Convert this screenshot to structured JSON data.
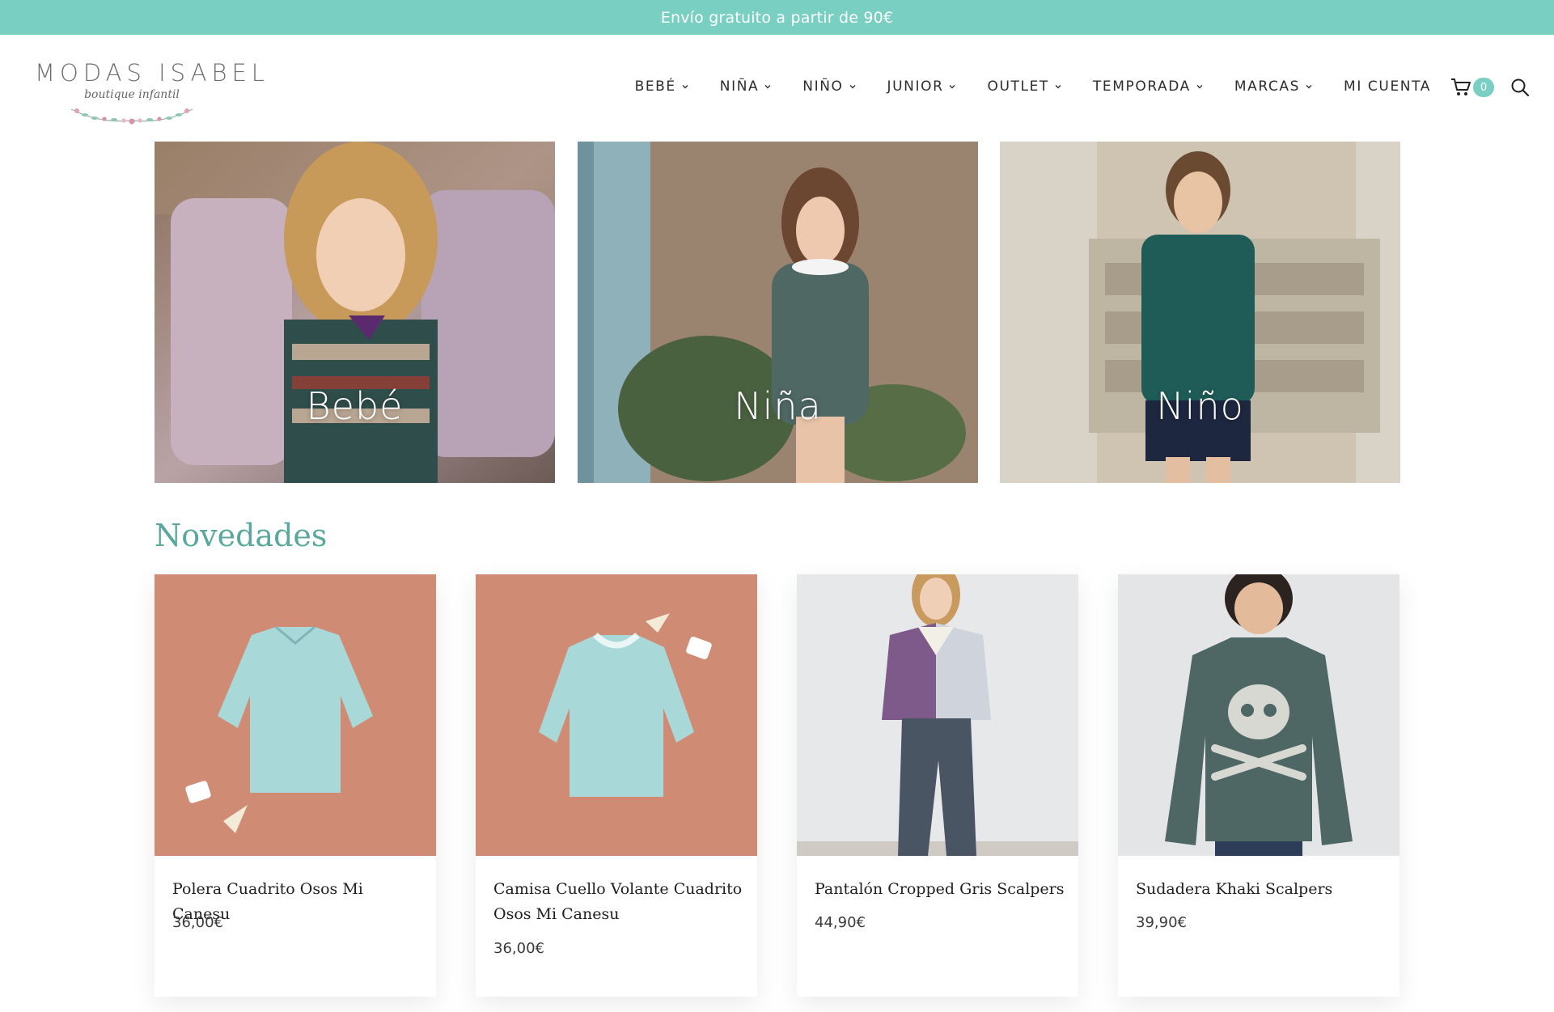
{
  "promo": {
    "text": "Envío gratuito a partir de 90€"
  },
  "logo": {
    "title": "MODAS ISABEL",
    "subtitle": "boutique infantil"
  },
  "nav": {
    "items": [
      {
        "label": "BEBÉ",
        "has_dropdown": true
      },
      {
        "label": "NIÑA",
        "has_dropdown": true
      },
      {
        "label": "NIÑO",
        "has_dropdown": true
      },
      {
        "label": "JUNIOR",
        "has_dropdown": true
      },
      {
        "label": "OUTLET",
        "has_dropdown": true
      },
      {
        "label": "TEMPORADA",
        "has_dropdown": true
      },
      {
        "label": "MARCAS",
        "has_dropdown": true
      },
      {
        "label": "MI CUENTA",
        "has_dropdown": false
      }
    ],
    "cart_count": "0",
    "icons": {
      "cart": "cart-icon",
      "search": "search-icon",
      "dropdown": "chevron-down-icon"
    }
  },
  "categories": [
    {
      "label": "Bebé"
    },
    {
      "label": "Niña"
    },
    {
      "label": "Niño"
    }
  ],
  "novedades": {
    "title": "Novedades",
    "products": [
      {
        "name": "Polera Cuadrito Osos Mi Canesu",
        "price": "36,00€"
      },
      {
        "name": "Camisa Cuello Volante Cuadrito Osos Mi Canesu",
        "price": "36,00€"
      },
      {
        "name": "Pantalón Cropped Gris Scalpers",
        "price": "44,90€"
      },
      {
        "name": "Sudadera Khaki Scalpers",
        "price": "39,90€"
      }
    ]
  },
  "colors": {
    "accent": "#79cfc2",
    "title": "#5aa89b",
    "text": "#2d2d2d"
  }
}
